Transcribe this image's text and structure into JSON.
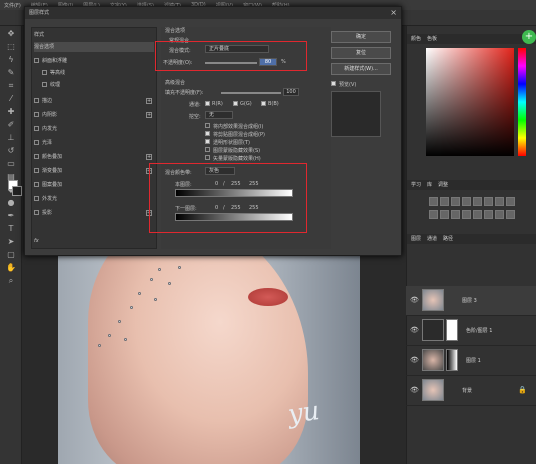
{
  "menubar": {
    "items": [
      "文件(F)",
      "编辑(E)",
      "图像(I)",
      "图层(L)",
      "文字(Y)",
      "选择(S)",
      "滤镜(T)",
      "3D(D)",
      "视图(V)",
      "窗口(W)",
      "帮助(H)"
    ]
  },
  "dialog": {
    "title": "图层样式",
    "styles_header": "样式",
    "blend_options": "混合选项",
    "style_items": [
      {
        "label": "斜面和浮雕",
        "checked": false,
        "plus": false
      },
      {
        "label": "等高线",
        "checked": false,
        "plus": false
      },
      {
        "label": "纹理",
        "checked": false,
        "plus": false
      },
      {
        "label": "描边",
        "checked": false,
        "plus": true
      },
      {
        "label": "内阴影",
        "checked": false,
        "plus": true
      },
      {
        "label": "内发光",
        "checked": false,
        "plus": false
      },
      {
        "label": "光泽",
        "checked": false,
        "plus": false
      },
      {
        "label": "颜色叠加",
        "checked": false,
        "plus": true
      },
      {
        "label": "渐变叠加",
        "checked": false,
        "plus": true
      },
      {
        "label": "图案叠加",
        "checked": false,
        "plus": false
      },
      {
        "label": "外发光",
        "checked": false,
        "plus": false
      },
      {
        "label": "投影",
        "checked": false,
        "plus": true
      }
    ],
    "fx_label": "fx",
    "section_blend": "混合选项",
    "general_blend": "常规混合",
    "blend_mode_label": "混合模式:",
    "blend_mode_value": "正片叠底",
    "opacity_label": "不透明度(O):",
    "opacity_value": "80",
    "opacity_unit": "%",
    "advanced_blend": "高级混合",
    "fill_opacity_label": "填充不透明度(F):",
    "fill_opacity_value": "100",
    "channels_label": "通道:",
    "channels": [
      "R(R)",
      "G(G)",
      "B(B)"
    ],
    "knockout_label": "挖空:",
    "knockout_value": "无",
    "adv_options": [
      "将内部效果混合成组(I)",
      "将剪贴图层混合成组(P)",
      "透明形状图层(T)",
      "图层蒙版隐藏效果(S)",
      "矢量蒙版隐藏效果(H)"
    ],
    "blend_if_label": "混合颜色带:",
    "blend_if_value": "灰色",
    "this_layer_label": "本图层:",
    "this_layer_values": [
      "0",
      "/",
      "255",
      "255"
    ],
    "under_layer_label": "下一图层:",
    "under_layer_values": [
      "0",
      "/",
      "255",
      "255"
    ],
    "buttons": {
      "ok": "确定",
      "reset": "复位",
      "new_style": "新建样式(W)...",
      "preview": "预览(V)"
    }
  },
  "right": {
    "tabs_top": [
      "颜色",
      "色板"
    ],
    "tabs_mid": [
      "学习",
      "库",
      "调整"
    ],
    "tabs_layers": [
      "图层",
      "通道",
      "路径"
    ],
    "layers": [
      {
        "name": "图层 3",
        "kind": "photo"
      },
      {
        "name": "色阶/图层 1",
        "kind": "mask"
      },
      {
        "name": "图层 1",
        "kind": "mask2"
      },
      {
        "name": "背景",
        "kind": "photo"
      }
    ]
  },
  "canvas": {
    "signature": "yu"
  }
}
